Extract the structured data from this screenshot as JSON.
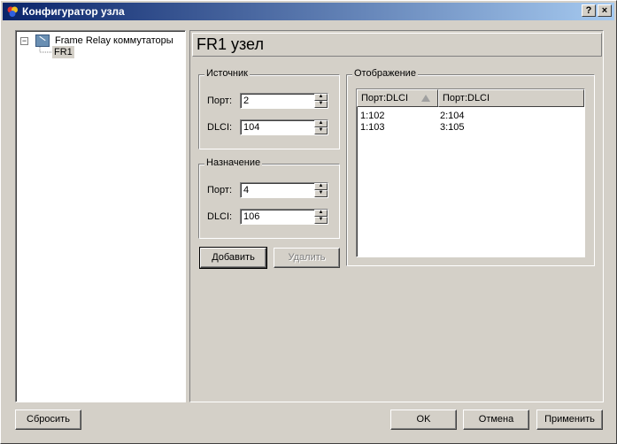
{
  "window": {
    "title": "Конфигуратор узла",
    "help_label": "?",
    "close_label": "×"
  },
  "tree": {
    "root_label": "Frame Relay коммутаторы",
    "root_expander": "−",
    "child_label": "FR1"
  },
  "main": {
    "title": "FR1 узел",
    "source": {
      "legend": "Источник",
      "port_label": "Порт:",
      "port_value": "2",
      "dlci_label": "DLCI:",
      "dlci_value": "104"
    },
    "destination": {
      "legend": "Назначение",
      "port_label": "Порт:",
      "port_value": "4",
      "dlci_label": "DLCI:",
      "dlci_value": "106"
    },
    "add_label": "Добавить",
    "delete_label": "Удалить",
    "mapping": {
      "legend": "Отображение",
      "columns": [
        "Порт:DLCI",
        "Порт:DLCI"
      ],
      "rows": [
        [
          "1:102",
          "2:104"
        ],
        [
          "1:103",
          "3:105"
        ]
      ]
    }
  },
  "footer": {
    "reset_label": "Сбросить",
    "ok_label": "OK",
    "cancel_label": "Отмена",
    "apply_label": "Применить"
  },
  "icons": {
    "tree_node": "network-switch-icon",
    "app": "app-icon"
  }
}
